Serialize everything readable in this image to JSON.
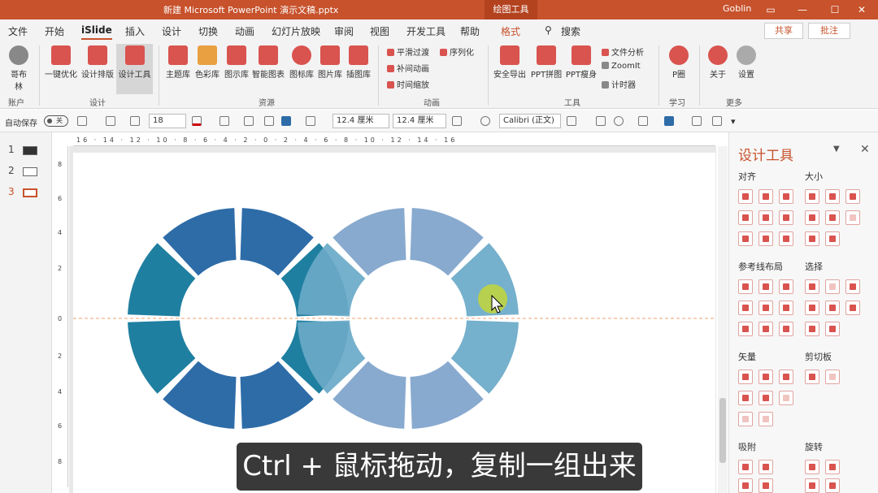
{
  "titlebar": {
    "document": "新建 Microsoft PowerPoint 演示文稿.pptx",
    "context_tab": "绘图工具",
    "user": "Goblin",
    "restore_icon": "restore-icon",
    "minimize": "—",
    "maximize": "☐",
    "close": "✕"
  },
  "tabs": [
    "文件",
    "开始",
    "iSlide",
    "插入",
    "设计",
    "切换",
    "动画",
    "幻灯片放映",
    "审阅",
    "视图",
    "开发工具",
    "帮助",
    "格式"
  ],
  "search": {
    "label": "搜索"
  },
  "share": {
    "label": "共享"
  },
  "comment": {
    "label": "批注"
  },
  "ribbon": {
    "account": {
      "name": "哥布林",
      "group": "账户"
    },
    "design": {
      "buttons": [
        "一键优化",
        "设计排版",
        "设计工具"
      ],
      "group": "设计"
    },
    "resources": {
      "buttons": [
        "主题库",
        "色彩库",
        "图示库",
        "智能图表",
        "图标库",
        "图片库",
        "插图库"
      ],
      "group": "资源"
    },
    "animation": {
      "buttons": [
        "平滑过渡",
        "补间动画",
        "时间缩放",
        "序列化"
      ],
      "group": "动画"
    },
    "tools": {
      "buttons": [
        "安全导出",
        "PPT拼图",
        "PPT瘦身"
      ],
      "small": [
        "文件分析",
        "ZoomIt",
        "计时器"
      ],
      "group": "工具"
    },
    "learn": {
      "buttons": [
        "P圈"
      ],
      "group": "学习"
    },
    "more": {
      "buttons": [
        "关于",
        "设置"
      ],
      "group": "更多"
    }
  },
  "format_bar": {
    "autosave": "自动保存",
    "autosave_state": "关",
    "font_size": "18",
    "height": "12.4 厘米",
    "width": "12.4 厘米",
    "font": "Calibri (正文)"
  },
  "slides": [
    {
      "num": "1"
    },
    {
      "num": "2"
    },
    {
      "num": "3"
    }
  ],
  "hruler": "16 · 14 · 12 · 10 · 8 · 6 · 4 · 2 · 0 · 2 · 4 · 6 · 8 · 10 · 12 · 14 · 16",
  "vruler": [
    "8",
    "6",
    "4",
    "2",
    "0",
    "2",
    "4",
    "6",
    "8"
  ],
  "subtitle": "Ctrl + 鼠标拖动，复制一组出来",
  "pane": {
    "title": "设计工具",
    "sections": [
      "对齐",
      "大小",
      "参考线布局",
      "选择",
      "矢量",
      "剪切板",
      "吸附",
      "旋转"
    ]
  },
  "colors": {
    "accent": "#c7522c",
    "ring_dark": "#2e6ca8",
    "ring_teal": "#1f7fa0",
    "ring_light": "#7fa3cc",
    "ring_light_teal": "#6aaac8",
    "guide": "#f0a070",
    "cursor_highlight": "#c8d830"
  }
}
